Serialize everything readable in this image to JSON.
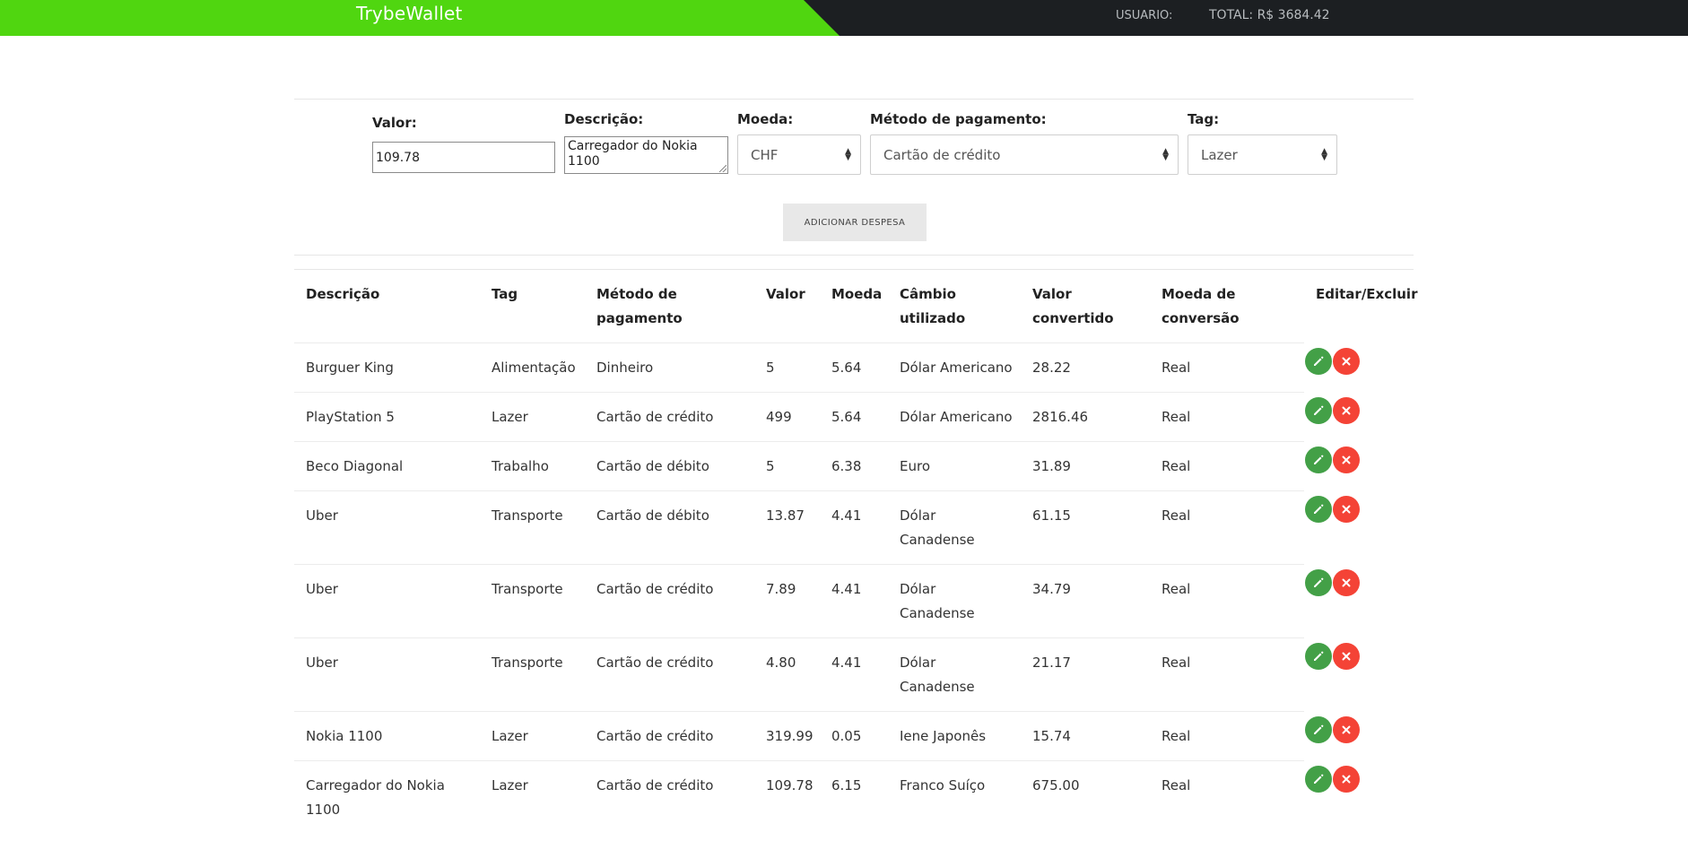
{
  "header": {
    "brand": "TrybeWallet",
    "user_label": "USUARIO:",
    "total_label": "TOTAL: R$ 3684.42",
    "colors": {
      "accent": "#50d610",
      "dark": "#1c1f22"
    }
  },
  "form": {
    "valor": {
      "label": "Valor:",
      "value": "109.78"
    },
    "descricao": {
      "label": "Descrição:",
      "value": "Carregador do Nokia 1100"
    },
    "moeda": {
      "label": "Moeda:",
      "value": "CHF"
    },
    "metodo": {
      "label": "Método de pagamento:",
      "value": "Cartão de crédito"
    },
    "tag": {
      "label": "Tag:",
      "value": "Lazer"
    },
    "add_button": "ADICIONAR DESPESA"
  },
  "table": {
    "headers": {
      "descricao": "Descrição",
      "tag": "Tag",
      "metodo_1": "Método de",
      "metodo_2": "pagamento",
      "valor": "Valor",
      "moeda": "Moeda",
      "cambio_1": "Câmbio",
      "cambio_2": "utilizado",
      "convertido_1": "Valor",
      "convertido_2": "convertido",
      "conversao_1": "Moeda de",
      "conversao_2": "conversão",
      "acoes": "Editar/Excluir"
    },
    "rows": [
      {
        "desc1": "Burguer King",
        "desc2": "",
        "tag": "Alimentação",
        "metodo": "Dinheiro",
        "valor": "5",
        "moeda": "5.64",
        "cambio1": "Dólar Americano",
        "cambio2": "",
        "convertido": "28.22",
        "conversao": "Real"
      },
      {
        "desc1": "PlayStation 5",
        "desc2": "",
        "tag": "Lazer",
        "metodo": "Cartão de crédito",
        "valor": "499",
        "moeda": "5.64",
        "cambio1": "Dólar Americano",
        "cambio2": "",
        "convertido": "2816.46",
        "conversao": "Real"
      },
      {
        "desc1": "Beco Diagonal",
        "desc2": "",
        "tag": "Trabalho",
        "metodo": "Cartão de débito",
        "valor": "5",
        "moeda": "6.38",
        "cambio1": "Euro",
        "cambio2": "",
        "convertido": "31.89",
        "conversao": "Real"
      },
      {
        "desc1": "Uber",
        "desc2": "",
        "tag": "Transporte",
        "metodo": "Cartão de débito",
        "valor": "13.87",
        "moeda": "4.41",
        "cambio1": "Dólar",
        "cambio2": "Canadense",
        "convertido": "61.15",
        "conversao": "Real"
      },
      {
        "desc1": "Uber",
        "desc2": "",
        "tag": "Transporte",
        "metodo": "Cartão de crédito",
        "valor": "7.89",
        "moeda": "4.41",
        "cambio1": "Dólar",
        "cambio2": "Canadense",
        "convertido": "34.79",
        "conversao": "Real"
      },
      {
        "desc1": "Uber",
        "desc2": "",
        "tag": "Transporte",
        "metodo": "Cartão de crédito",
        "valor": "4.80",
        "moeda": "4.41",
        "cambio1": "Dólar",
        "cambio2": "Canadense",
        "convertido": "21.17",
        "conversao": "Real"
      },
      {
        "desc1": "Nokia 1100",
        "desc2": "",
        "tag": "Lazer",
        "metodo": "Cartão de crédito",
        "valor": "319.99",
        "moeda": "0.05",
        "cambio1": "Iene Japonês",
        "cambio2": "",
        "convertido": "15.74",
        "conversao": "Real"
      },
      {
        "desc1": "Carregador do Nokia",
        "desc2": "1100",
        "tag": "Lazer",
        "metodo": "Cartão de crédito",
        "valor": "109.78",
        "moeda": "6.15",
        "cambio1": "Franco Suíço",
        "cambio2": "",
        "convertido": "675.00",
        "conversao": "Real"
      }
    ],
    "icons": {
      "edit": "pencil-icon",
      "delete": "close-icon"
    }
  }
}
